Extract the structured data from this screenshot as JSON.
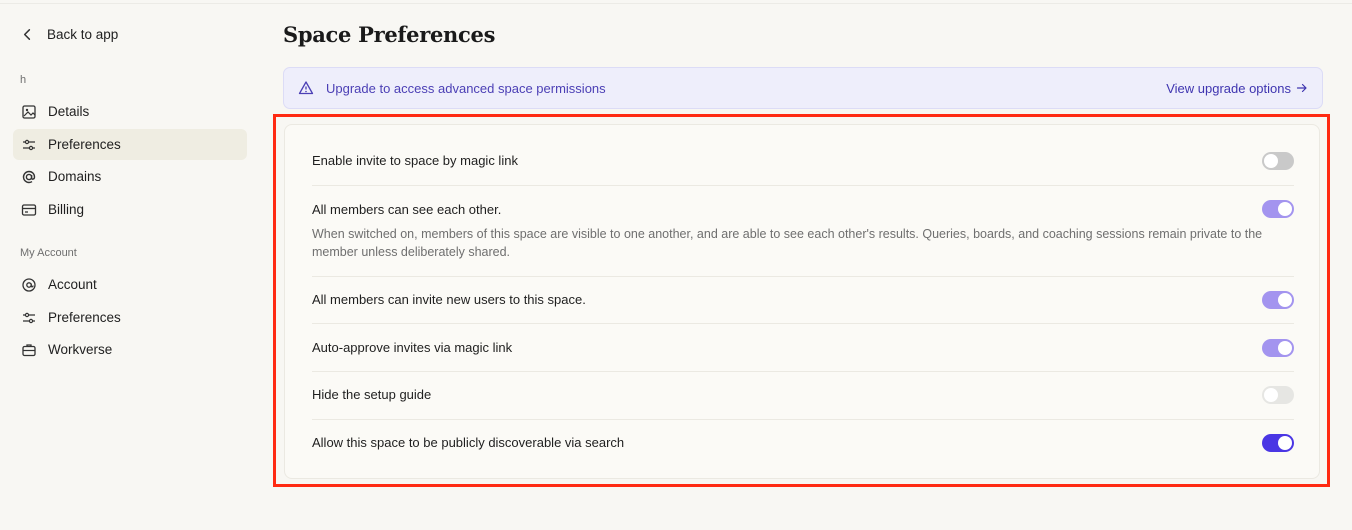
{
  "sidebar": {
    "back_label": "Back to app",
    "space_section": "h",
    "space_items": [
      {
        "label": "Details",
        "icon": "image-icon"
      },
      {
        "label": "Preferences",
        "icon": "sliders-icon",
        "active": true
      },
      {
        "label": "Domains",
        "icon": "at-icon"
      },
      {
        "label": "Billing",
        "icon": "credit-card-icon"
      }
    ],
    "account_section": "My Account",
    "account_items": [
      {
        "label": "Account",
        "icon": "at-circle-icon"
      },
      {
        "label": "Preferences",
        "icon": "sliders-icon"
      },
      {
        "label": "Workverse",
        "icon": "briefcase-icon"
      }
    ]
  },
  "main": {
    "title": "Space Preferences",
    "banner": {
      "text": "Upgrade to access advanced space permissions",
      "link": "View upgrade options"
    },
    "settings": [
      {
        "label": "Enable invite to space by magic link",
        "state": "off",
        "color": "#c9c9c9"
      },
      {
        "label": "All members can see each other.",
        "description": "When switched on, members of this space are visible to one another, and are able to see each other's results. Queries, boards, and coaching sessions remain private to the member unless deliberately shared.",
        "state": "on",
        "color": "#a394ef"
      },
      {
        "label": "All members can invite new users to this space.",
        "state": "on",
        "color": "#a394ef"
      },
      {
        "label": "Auto-approve invites via magic link",
        "state": "on",
        "color": "#a394ef"
      },
      {
        "label": "Hide the setup guide",
        "state": "off",
        "color": "#e6e6e3"
      },
      {
        "label": "Allow this space to be publicly discoverable via search",
        "state": "on",
        "color": "#4a36e4"
      }
    ]
  },
  "colors": {
    "accent": "#4a36e4",
    "highlight": "#ff2a12"
  }
}
